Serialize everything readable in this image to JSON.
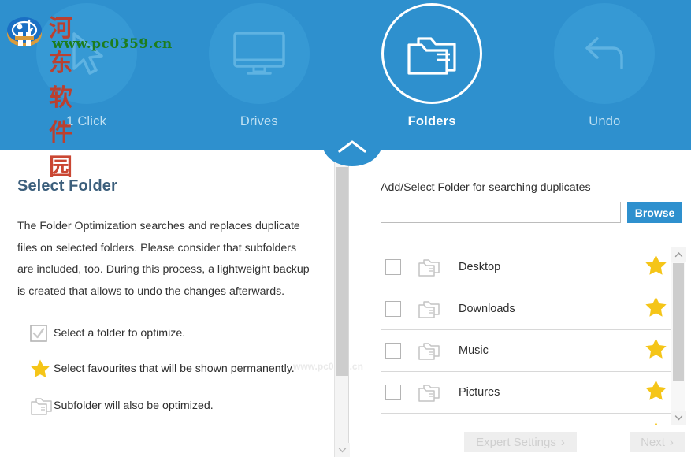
{
  "header": {
    "background_color": "#2e90ce",
    "nav_items": [
      {
        "label": "1 Click",
        "icon": "cursor-arrow-icon",
        "active": false
      },
      {
        "label": "Drives",
        "icon": "monitor-icon",
        "active": false
      },
      {
        "label": "Folders",
        "icon": "folders-icon",
        "active": true
      },
      {
        "label": "Undo",
        "icon": "undo-arrow-icon",
        "active": false
      }
    ],
    "collapse_tab_icon": "chevron-up-icon"
  },
  "watermark": {
    "logo": "site-logo-icon",
    "site_name": "河东软件园",
    "site_url": "www.pc0359.cn",
    "faint_overlay": "www.pc0359.cn"
  },
  "left_panel": {
    "title": "Select Folder",
    "description": "The Folder Optimization searches and replaces duplicate files on selected folders. Please consider that subfolders are included, too. During this process, a lightweight backup is created that allows to undo the changes afterwards.",
    "legend": [
      {
        "icon": "checkbox-checked-icon",
        "text": "Select a folder to optimize."
      },
      {
        "icon": "star-icon",
        "text": "Select favourites that will be shown permanently."
      },
      {
        "icon": "subfolder-icon",
        "text": "Subfolder will also be optimized."
      }
    ],
    "scrollbar": {
      "up_icon": "chevron-up-icon",
      "down_icon": "chevron-down-icon"
    }
  },
  "right_panel": {
    "field_label": "Add/Select Folder for searching duplicates",
    "path_input": {
      "value": "",
      "placeholder": ""
    },
    "browse_label": "Browse",
    "folders": [
      {
        "name": "Desktop",
        "checked": false,
        "favourite": true,
        "folder_icon": "folder-icon",
        "star_icon": "star-icon"
      },
      {
        "name": "Downloads",
        "checked": false,
        "favourite": true,
        "folder_icon": "folder-icon",
        "star_icon": "star-icon"
      },
      {
        "name": "Music",
        "checked": false,
        "favourite": true,
        "folder_icon": "folder-icon",
        "star_icon": "star-icon"
      },
      {
        "name": "Pictures",
        "checked": false,
        "favourite": true,
        "folder_icon": "folder-icon",
        "star_icon": "star-icon"
      },
      {
        "name": "",
        "checked": false,
        "favourite": true,
        "folder_icon": "folder-icon",
        "star_icon": "star-icon"
      }
    ],
    "scrollbar": {
      "up_icon": "chevron-up-icon",
      "down_icon": "chevron-down-icon"
    }
  },
  "footer": {
    "expert_settings_label": "Expert Settings",
    "expert_settings_chevron": "›",
    "next_label": "Next",
    "next_chevron": "›",
    "disabled": true
  },
  "colors": {
    "accent_blue": "#2e90ce",
    "nav_circle_blue": "#3699d4",
    "title_slate": "#3c5f7c",
    "star_yellow": "#f5c518",
    "disabled_grey": "#cfcfcf"
  }
}
